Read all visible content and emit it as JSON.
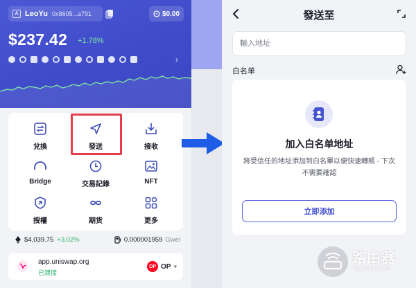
{
  "wallet": {
    "account_badge": "A",
    "account_name": "LeoYu",
    "account_address": "0x8605...a791",
    "balance_chip": "$0.00",
    "total_balance": "$237.42",
    "change_pct": "+1.78%",
    "actions": [
      {
        "label": "兌換",
        "icon": "swap-icon"
      },
      {
        "label": "發送",
        "icon": "send-icon"
      },
      {
        "label": "接收",
        "icon": "receive-icon"
      },
      {
        "label": "Bridge",
        "icon": "bridge-icon"
      },
      {
        "label": "交易記錄",
        "icon": "history-icon"
      },
      {
        "label": "NFT",
        "icon": "nft-icon"
      },
      {
        "label": "授權",
        "icon": "approval-icon"
      },
      {
        "label": "期货",
        "icon": "futures-icon"
      },
      {
        "label": "更多",
        "icon": "more-icon"
      }
    ],
    "eth_price": "$4,039.75",
    "eth_change": "+3.02%",
    "gas_price": "0.000001959",
    "gas_unit": "Gwei",
    "dapp_url": "app.uniswap.org",
    "dapp_status": "已連接",
    "network": "OP",
    "colors": {
      "accent": "#4653d1",
      "positive": "#2bb56a",
      "highlight": "#e83c4c"
    }
  },
  "send": {
    "title": "發送至",
    "address_placeholder": "輸入地址",
    "whitelist_label": "白名单",
    "empty_title": "加入白名单地址",
    "empty_desc": "將受信任的地址添加到白名單以便快速轉賬 - 下次不需要確認",
    "add_button": "立即添加"
  },
  "watermark": {
    "text": "路由器",
    "sub": "luyouqi.com"
  }
}
